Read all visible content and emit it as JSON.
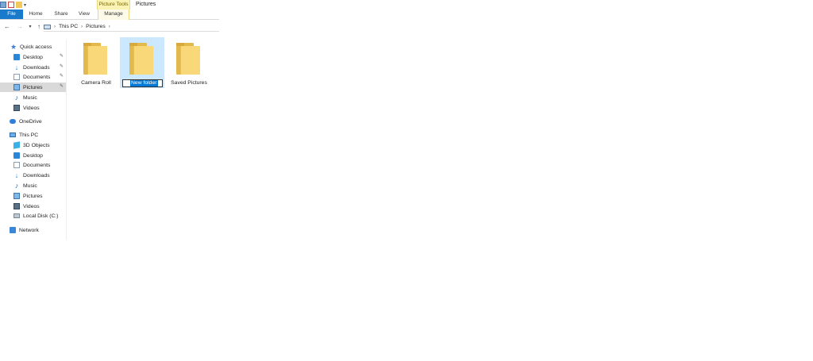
{
  "window": {
    "title": "Pictures",
    "contextual_tab": "Picture Tools"
  },
  "ribbon": {
    "tabs": [
      "File",
      "Home",
      "Share",
      "View",
      "Manage"
    ]
  },
  "address": {
    "crumbs": [
      "This PC",
      "Pictures"
    ]
  },
  "nav": {
    "quick_access": "Quick access",
    "quick_items": [
      {
        "label": "Desktop",
        "icon": "desktop-icon",
        "pinned": true
      },
      {
        "label": "Downloads",
        "icon": "downloads-icon",
        "pinned": true
      },
      {
        "label": "Documents",
        "icon": "documents-icon",
        "pinned": true
      },
      {
        "label": "Pictures",
        "icon": "pictures-icon",
        "pinned": true,
        "selected": true
      },
      {
        "label": "Music",
        "icon": "music-icon",
        "pinned": false
      },
      {
        "label": "Videos",
        "icon": "videos-icon",
        "pinned": false
      }
    ],
    "onedrive": "OneDrive",
    "this_pc": "This PC",
    "pc_items": [
      {
        "label": "3D Objects",
        "icon": "3d-objects-icon"
      },
      {
        "label": "Desktop",
        "icon": "desktop-icon"
      },
      {
        "label": "Documents",
        "icon": "documents-icon"
      },
      {
        "label": "Downloads",
        "icon": "downloads-icon"
      },
      {
        "label": "Music",
        "icon": "music-icon"
      },
      {
        "label": "Pictures",
        "icon": "pictures-icon"
      },
      {
        "label": "Videos",
        "icon": "videos-icon"
      },
      {
        "label": "Local Disk (C:)",
        "icon": "local-disk-icon"
      }
    ],
    "network": "Network"
  },
  "content": {
    "folders": [
      {
        "name": "Camera Roll"
      },
      {
        "name": "New folder",
        "renaming": true
      },
      {
        "name": "Saved Pictures"
      }
    ]
  }
}
